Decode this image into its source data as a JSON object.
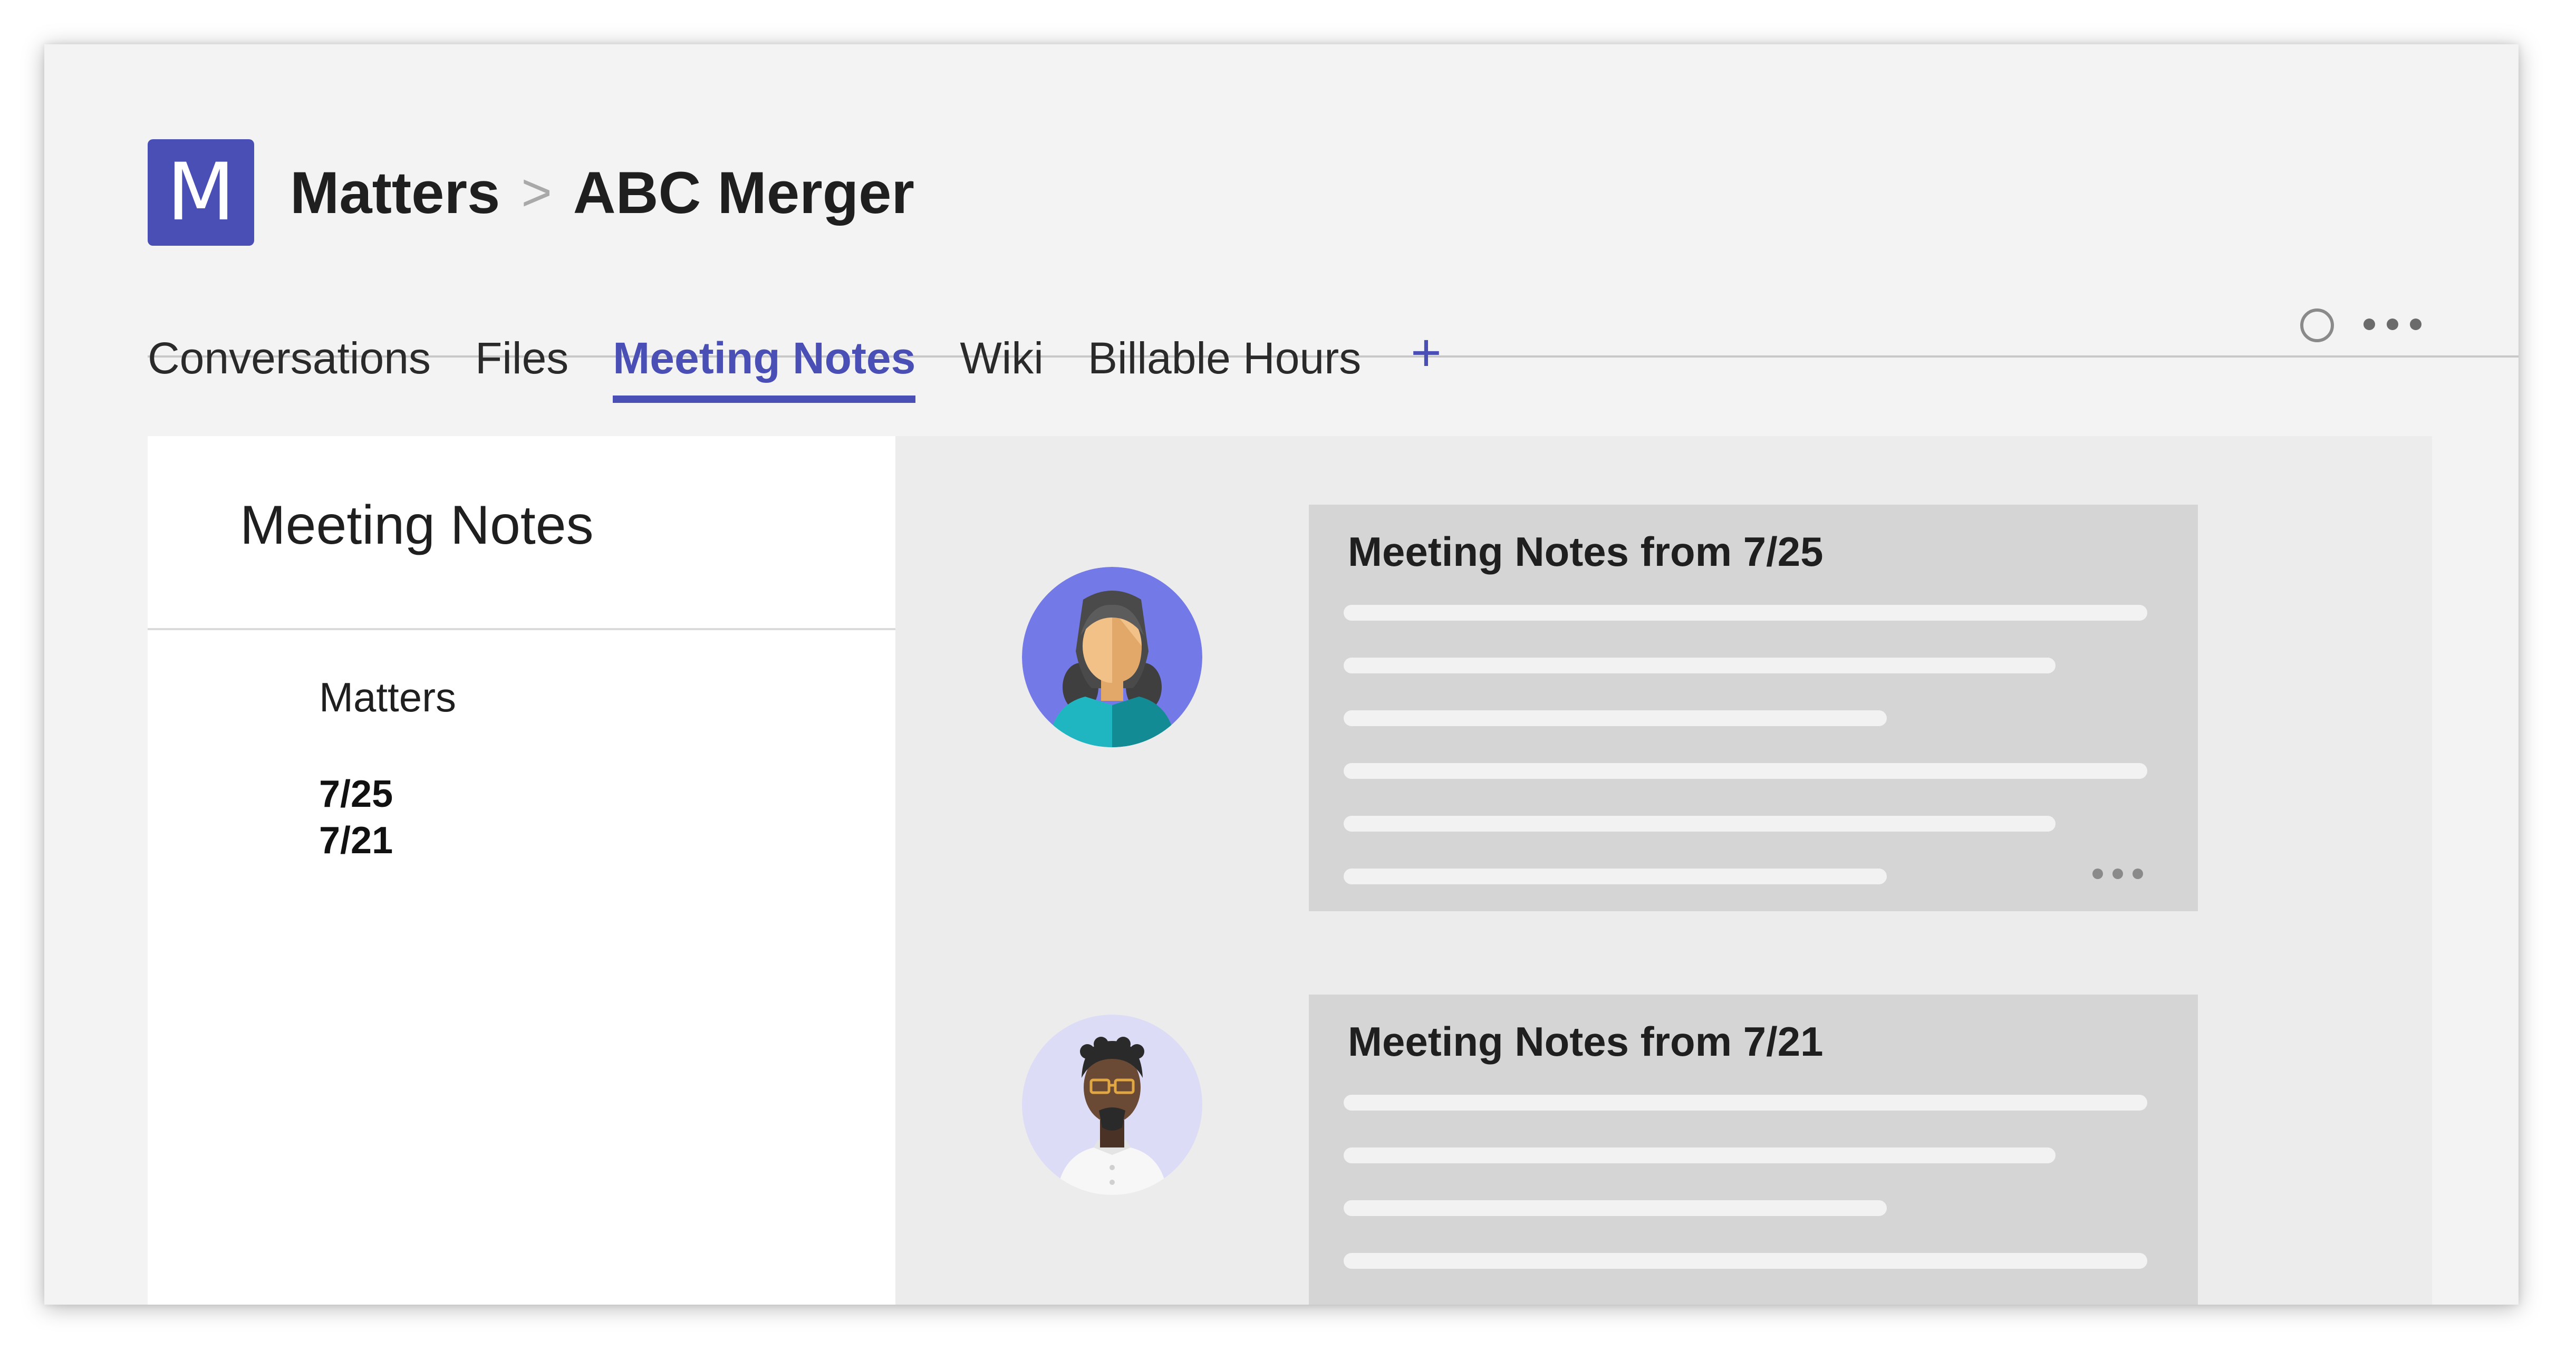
{
  "header": {
    "logo_letter": "M",
    "breadcrumb": {
      "parent": "Matters",
      "separator": ">",
      "current": "ABC Merger"
    }
  },
  "tabs": [
    {
      "label": "Conversations",
      "active": false
    },
    {
      "label": "Files",
      "active": false
    },
    {
      "label": "Meeting Notes",
      "active": true
    },
    {
      "label": "Wiki",
      "active": false
    },
    {
      "label": "Billable Hours",
      "active": false
    }
  ],
  "tab_add_label": "+",
  "toolbar_icons": [
    "status-circle-icon",
    "more-options-icon"
  ],
  "left_panel": {
    "title": "Meeting Notes",
    "section_label": "Matters",
    "dates": [
      "7/25",
      "7/21"
    ]
  },
  "notes": [
    {
      "title": "Meeting Notes from 7/25",
      "avatar": "woman-avatar-icon"
    },
    {
      "title": "Meeting Notes from 7/21",
      "avatar": "man-avatar-icon"
    }
  ],
  "colors": {
    "accent": "#4a4fb6",
    "window_bg": "#f3f3f3",
    "content_bg": "#ececec",
    "card_bg": "#d5d5d5",
    "avatar_1_bg": "#7479e8",
    "avatar_2_bg": "#dcdcf6"
  }
}
